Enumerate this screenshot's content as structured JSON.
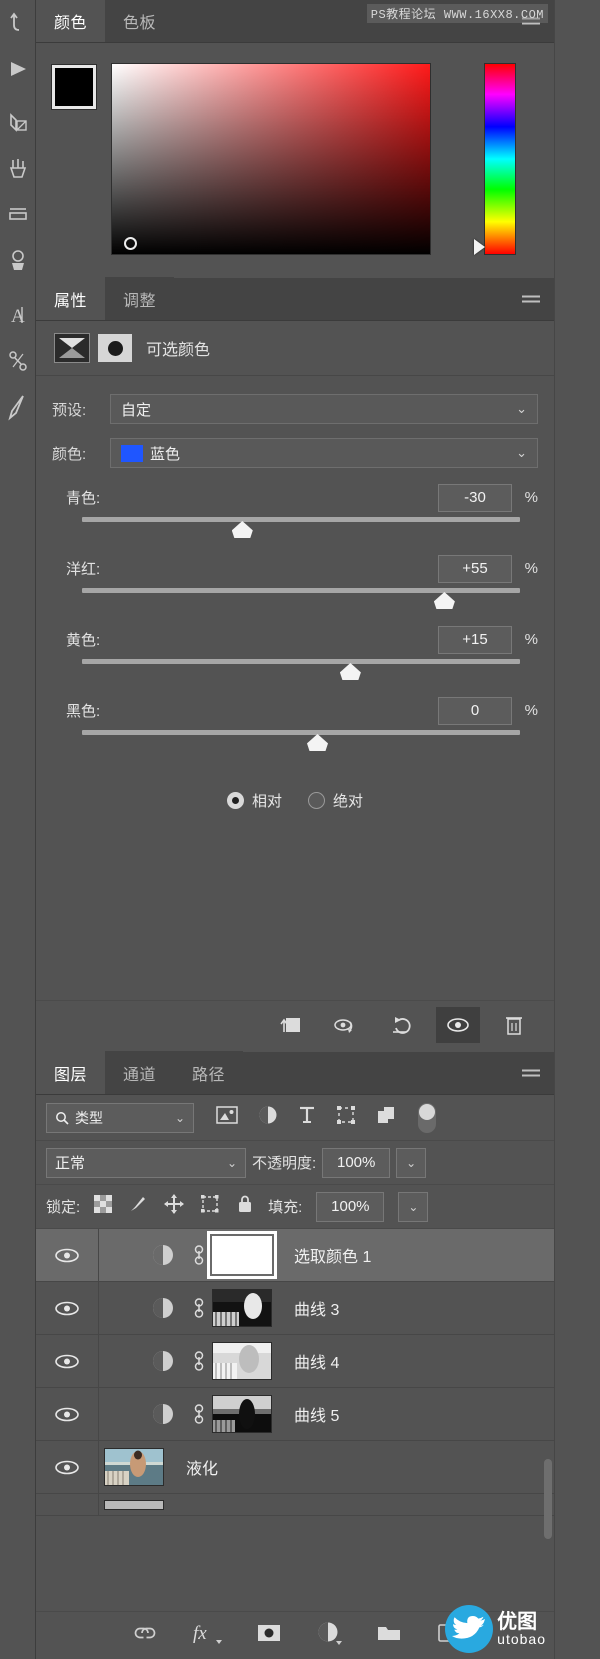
{
  "watermarks": {
    "top": "PS教程论坛 WWW.16XX8.COM",
    "bottom_cn": "优图",
    "bottom_en": "utobao"
  },
  "toolbar": {
    "tools": [
      {
        "name": "history-undo-tool",
        "glyph": "undo"
      },
      {
        "name": "play-tool",
        "glyph": "play"
      },
      {
        "name": "pen-tool",
        "glyph": "pen"
      },
      {
        "name": "brush-tool",
        "glyph": "brush"
      },
      {
        "name": "eraser-tool",
        "glyph": "eraser"
      },
      {
        "name": "stamp-tool",
        "glyph": "stamp"
      },
      {
        "name": "type-tool",
        "glyph": "type"
      },
      {
        "name": "path-tool",
        "glyph": "path"
      },
      {
        "name": "lasso-tool",
        "glyph": "lasso"
      }
    ]
  },
  "color_panel": {
    "tabs": [
      {
        "label": "颜色",
        "active": true
      },
      {
        "label": "色板",
        "active": false
      }
    ],
    "foreground": "#000000",
    "background": "#ffffff",
    "hue_accent": "#ff1a1a"
  },
  "properties_panel": {
    "tabs": [
      {
        "label": "属性",
        "active": true
      },
      {
        "label": "调整",
        "active": false
      }
    ],
    "adjustment_title": "可选颜色",
    "preset_label": "预设:",
    "preset_value": "自定",
    "color_label": "颜色:",
    "color_value": "蓝色",
    "color_swatch": "#1f56ff",
    "sliders": [
      {
        "name": "青色:",
        "value": "-30",
        "unit": "%",
        "percent": 34
      },
      {
        "name": "洋红:",
        "value": "+55",
        "unit": "%",
        "percent": 77
      },
      {
        "name": "黄色:",
        "value": "+15",
        "unit": "%",
        "percent": 57
      },
      {
        "name": "黑色:",
        "value": "0",
        "unit": "%",
        "percent": 50
      }
    ],
    "method": [
      {
        "label": "相对",
        "selected": true
      },
      {
        "label": "绝对",
        "selected": false
      }
    ],
    "footer_buttons": [
      {
        "name": "clip-to-layer-icon",
        "active": false
      },
      {
        "name": "toggle-preview-icon",
        "active": false
      },
      {
        "name": "reset-icon",
        "active": false
      },
      {
        "name": "visibility-eye-icon",
        "active": true
      },
      {
        "name": "delete-trash-icon",
        "active": false
      }
    ]
  },
  "layers_panel": {
    "tabs": [
      {
        "label": "图层",
        "active": true
      },
      {
        "label": "通道",
        "active": false
      },
      {
        "label": "路径",
        "active": false
      }
    ],
    "filter": {
      "value": "类型",
      "icons": [
        "image-filter-icon",
        "adjustment-filter-icon",
        "type-filter-icon",
        "shape-filter-icon",
        "smart-object-filter-icon"
      ],
      "toggle_name": "filter-enable-toggle"
    },
    "blend_mode": "正常",
    "opacity_label": "不透明度:",
    "opacity_value": "100%",
    "lock_label": "锁定:",
    "lock_icons": [
      "lock-transparency-icon",
      "lock-image-icon",
      "lock-position-icon",
      "lock-artboard-icon",
      "lock-all-icon"
    ],
    "fill_label": "填充:",
    "fill_value": "100%",
    "layers": [
      {
        "name": "选取颜色 1",
        "type": "adjustment",
        "selected": true,
        "visible": true,
        "linked": true,
        "thumb": "white-mask"
      },
      {
        "name": "曲线 3",
        "type": "adjustment",
        "selected": false,
        "visible": true,
        "linked": true,
        "thumb": "bw-photo-a"
      },
      {
        "name": "曲线 4",
        "type": "adjustment",
        "selected": false,
        "visible": true,
        "linked": true,
        "thumb": "bw-photo-b"
      },
      {
        "name": "曲线 5",
        "type": "adjustment",
        "selected": false,
        "visible": true,
        "linked": true,
        "thumb": "bw-photo-c"
      },
      {
        "name": "液化",
        "type": "pixel",
        "selected": false,
        "visible": true,
        "linked": false,
        "thumb": "color-photo"
      }
    ],
    "footer_buttons": [
      {
        "name": "link-layers-icon"
      },
      {
        "name": "layer-style-fx-icon"
      },
      {
        "name": "add-layer-mask-icon"
      },
      {
        "name": "new-adjustment-layer-icon"
      },
      {
        "name": "new-group-icon"
      },
      {
        "name": "new-layer-icon"
      }
    ]
  }
}
